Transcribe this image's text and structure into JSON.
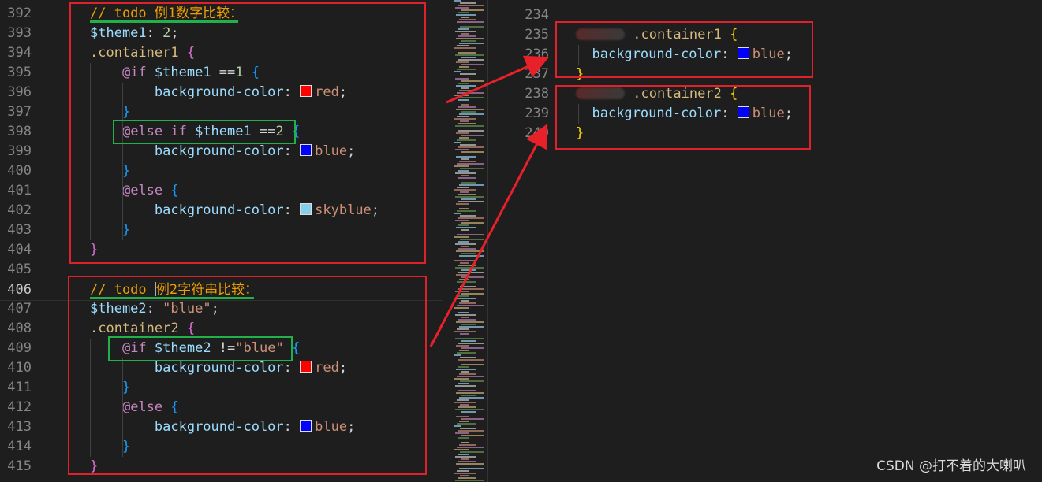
{
  "left_editor": {
    "lines": [
      {
        "n": "392",
        "tokens": [
          {
            "t": "// todo 例1数字比较：",
            "c": "com"
          }
        ]
      },
      {
        "n": "393",
        "tokens": [
          {
            "t": "$theme1",
            "c": "var"
          },
          {
            "t": ": ",
            "c": "pun"
          },
          {
            "t": "2",
            "c": "num"
          },
          {
            "t": ";",
            "c": "pun"
          }
        ]
      },
      {
        "n": "394",
        "tokens": [
          {
            "t": ".container1 ",
            "c": "sel"
          },
          {
            "t": "{",
            "c": "b1"
          }
        ]
      },
      {
        "n": "395",
        "tokens": [
          {
            "t": "    "
          },
          {
            "t": "@if ",
            "c": "kw"
          },
          {
            "t": "$theme1",
            "c": "var"
          },
          {
            "t": " ==",
            "c": "pun"
          },
          {
            "t": "1",
            "c": "num"
          },
          {
            "t": " ",
            "c": "pun"
          },
          {
            "t": "{",
            "c": "b2"
          }
        ]
      },
      {
        "n": "396",
        "tokens": [
          {
            "t": "        "
          },
          {
            "t": "background-color",
            "c": "prop"
          },
          {
            "t": ": ",
            "c": "pun"
          },
          {
            "sw": "#ff0000"
          },
          {
            "t": "red",
            "c": "str"
          },
          {
            "t": ";",
            "c": "pun"
          }
        ]
      },
      {
        "n": "397",
        "tokens": [
          {
            "t": "    "
          },
          {
            "t": "}",
            "c": "b2"
          }
        ]
      },
      {
        "n": "398",
        "tokens": [
          {
            "t": "    "
          },
          {
            "t": "@else if ",
            "c": "kw"
          },
          {
            "t": "$theme1",
            "c": "var"
          },
          {
            "t": " ==",
            "c": "pun"
          },
          {
            "t": "2",
            "c": "num"
          },
          {
            "t": " ",
            "c": "pun"
          },
          {
            "t": "{",
            "c": "b2"
          }
        ]
      },
      {
        "n": "399",
        "tokens": [
          {
            "t": "        "
          },
          {
            "t": "background-color",
            "c": "prop"
          },
          {
            "t": ": ",
            "c": "pun"
          },
          {
            "sw": "#0000ff"
          },
          {
            "t": "blue",
            "c": "str"
          },
          {
            "t": ";",
            "c": "pun"
          }
        ]
      },
      {
        "n": "400",
        "tokens": [
          {
            "t": "    "
          },
          {
            "t": "}",
            "c": "b2"
          }
        ]
      },
      {
        "n": "401",
        "tokens": [
          {
            "t": "    "
          },
          {
            "t": "@else ",
            "c": "kw"
          },
          {
            "t": "{",
            "c": "b2"
          }
        ]
      },
      {
        "n": "402",
        "tokens": [
          {
            "t": "        "
          },
          {
            "t": "background-color",
            "c": "prop"
          },
          {
            "t": ": ",
            "c": "pun"
          },
          {
            "sw": "#87ceeb"
          },
          {
            "t": "skyblue",
            "c": "str"
          },
          {
            "t": ";",
            "c": "pun"
          }
        ]
      },
      {
        "n": "403",
        "tokens": [
          {
            "t": "    "
          },
          {
            "t": "}",
            "c": "b2"
          }
        ]
      },
      {
        "n": "404",
        "tokens": [
          {
            "t": "}",
            "c": "b1"
          }
        ]
      },
      {
        "n": "405",
        "tokens": []
      },
      {
        "n": "406",
        "active": true,
        "tokens": [
          {
            "t": "// todo ",
            "c": "com"
          },
          {
            "cursor": true
          },
          {
            "t": "例2字符串比较：",
            "c": "com"
          }
        ]
      },
      {
        "n": "407",
        "tokens": [
          {
            "t": "$theme2",
            "c": "var"
          },
          {
            "t": ": ",
            "c": "pun"
          },
          {
            "t": "\"blue\"",
            "c": "str"
          },
          {
            "t": ";",
            "c": "pun"
          }
        ]
      },
      {
        "n": "408",
        "tokens": [
          {
            "t": ".container2 ",
            "c": "sel"
          },
          {
            "t": "{",
            "c": "b1"
          }
        ]
      },
      {
        "n": "409",
        "tokens": [
          {
            "t": "    "
          },
          {
            "t": "@if ",
            "c": "kw"
          },
          {
            "t": "$theme2",
            "c": "var"
          },
          {
            "t": " !=",
            "c": "pun"
          },
          {
            "t": "\"blue\"",
            "c": "str"
          },
          {
            "t": " ",
            "c": "pun"
          },
          {
            "t": "{",
            "c": "b2"
          }
        ]
      },
      {
        "n": "410",
        "tokens": [
          {
            "t": "        "
          },
          {
            "t": "background-color",
            "c": "prop"
          },
          {
            "t": ": ",
            "c": "pun"
          },
          {
            "sw": "#ff0000"
          },
          {
            "t": "red",
            "c": "str"
          },
          {
            "t": ";",
            "c": "pun"
          }
        ]
      },
      {
        "n": "411",
        "tokens": [
          {
            "t": "    "
          },
          {
            "t": "}",
            "c": "b2"
          }
        ]
      },
      {
        "n": "412",
        "tokens": [
          {
            "t": "    "
          },
          {
            "t": "@else ",
            "c": "kw"
          },
          {
            "t": "{",
            "c": "b2"
          }
        ]
      },
      {
        "n": "413",
        "tokens": [
          {
            "t": "        "
          },
          {
            "t": "background-color",
            "c": "prop"
          },
          {
            "t": ": ",
            "c": "pun"
          },
          {
            "sw": "#0000ff"
          },
          {
            "t": "blue",
            "c": "str"
          },
          {
            "t": ";",
            "c": "pun"
          }
        ]
      },
      {
        "n": "414",
        "tokens": [
          {
            "t": "    "
          },
          {
            "t": "}",
            "c": "b2"
          }
        ]
      },
      {
        "n": "415",
        "tokens": [
          {
            "t": "}",
            "c": "b1"
          }
        ]
      }
    ]
  },
  "right_editor": {
    "lines": [
      {
        "n": "234",
        "tokens": []
      },
      {
        "n": "235",
        "tokens": [
          {
            "blur": true
          },
          {
            "t": " .container1 ",
            "c": "sel"
          },
          {
            "t": "{",
            "c": "b3"
          }
        ]
      },
      {
        "n": "236",
        "tokens": [
          {
            "t": "  "
          },
          {
            "t": "background-color",
            "c": "prop"
          },
          {
            "t": ": ",
            "c": "pun"
          },
          {
            "sw": "#0000ff"
          },
          {
            "t": "blue",
            "c": "str"
          },
          {
            "t": ";",
            "c": "pun"
          }
        ]
      },
      {
        "n": "237",
        "tokens": [
          {
            "t": "}",
            "c": "b3"
          }
        ]
      },
      {
        "n": "238",
        "tokens": [
          {
            "blur": true
          },
          {
            "t": " .container2 ",
            "c": "sel"
          },
          {
            "t": "{",
            "c": "b3"
          }
        ]
      },
      {
        "n": "239",
        "tokens": [
          {
            "t": "  "
          },
          {
            "t": "background-color",
            "c": "prop"
          },
          {
            "t": ": ",
            "c": "pun"
          },
          {
            "sw": "#0000ff"
          },
          {
            "t": "blue",
            "c": "str"
          },
          {
            "t": ";",
            "c": "pun"
          }
        ]
      },
      {
        "n": "240",
        "tokens": [
          {
            "t": "}",
            "c": "b3"
          }
        ]
      }
    ]
  },
  "watermark": "CSDN @打不着的大喇叭",
  "colors": {
    "annotation_box": "#e0202a",
    "highlight_box": "#22b04a",
    "arrow": "#e8202a"
  }
}
